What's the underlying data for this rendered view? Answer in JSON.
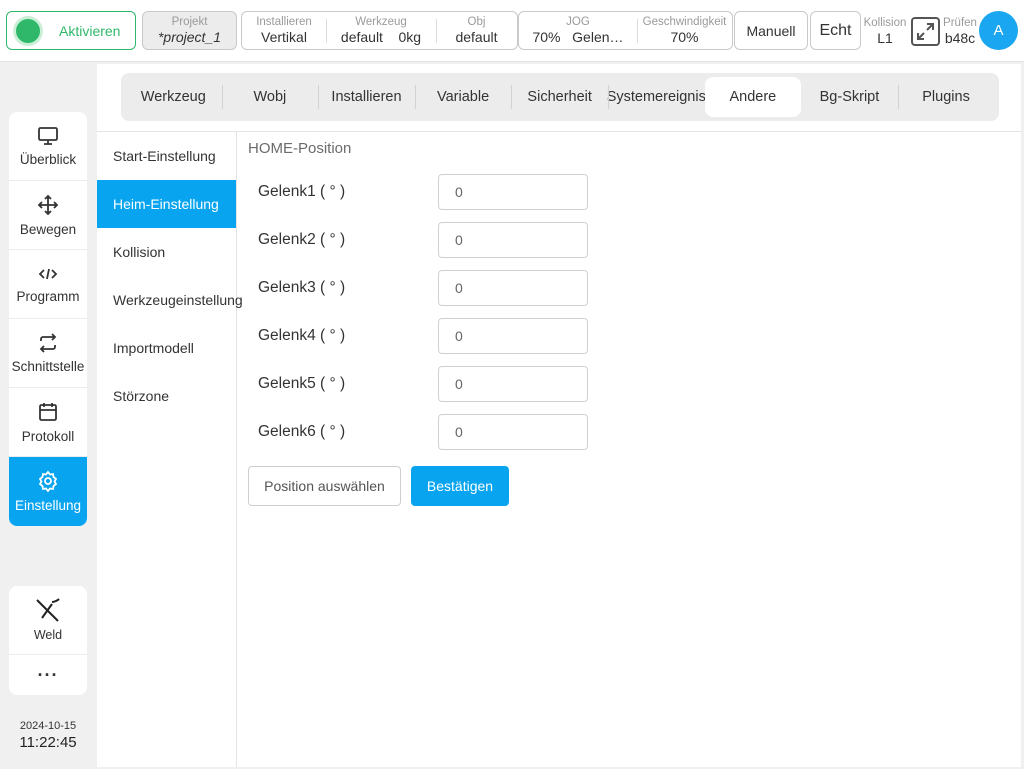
{
  "topbar": {
    "activate_label": "Aktivieren",
    "project": {
      "caption": "Projekt",
      "value": "*project_1"
    },
    "install": {
      "caption": "Installieren",
      "value": "Vertikal"
    },
    "tool": {
      "caption": "Werkzeug",
      "value": "default",
      "extra": "0kg"
    },
    "obj": {
      "caption": "Obj",
      "value": "default"
    },
    "jog": {
      "caption": "JOG",
      "value": "70%",
      "extra": "Gelen…"
    },
    "speed": {
      "caption": "Geschwindigkeit",
      "value": "70%"
    },
    "mode_button": "Manuell",
    "real_button": "Echt",
    "collision": {
      "caption": "Kollision",
      "value": "L1"
    },
    "check": {
      "caption": "Prüfen",
      "value": "b48c"
    },
    "avatar_letter": "A",
    "colors": {
      "active_green": "#2fb86a",
      "accent_blue": "#08a4ef"
    }
  },
  "leftnav": {
    "items": [
      {
        "label": "Überblick",
        "icon": "monitor-icon"
      },
      {
        "label": "Bewegen",
        "icon": "move-arrows-icon"
      },
      {
        "label": "Programm",
        "icon": "code-icon"
      },
      {
        "label": "Schnittstelle",
        "icon": "swap-arrows-icon"
      },
      {
        "label": "Protokoll",
        "icon": "calendar-icon"
      },
      {
        "label": "Einstellung",
        "icon": "gear-icon",
        "active": true
      }
    ],
    "weld_label": "Weld",
    "more_label": "···"
  },
  "clock": {
    "date": "2024-10-15",
    "time": "11:22:45"
  },
  "tabs": [
    "Werkzeug",
    "Wobj",
    "Installieren",
    "Variable",
    "Sicherheit",
    "Systemereignis",
    "Andere",
    "Bg-Skript",
    "Plugins"
  ],
  "active_tab": "Andere",
  "subnav": [
    "Start-Einstellung",
    "Heim-Einstellung",
    "Kollision",
    "Werkzeugeinstellung",
    "Importmodell",
    "Störzone"
  ],
  "active_subnav": "Heim-Einstellung",
  "home": {
    "title": "HOME-Position",
    "joints": [
      {
        "label": "Gelenk1 ( ° )",
        "value": "0"
      },
      {
        "label": "Gelenk2 ( ° )",
        "value": "0"
      },
      {
        "label": "Gelenk3 ( ° )",
        "value": "0"
      },
      {
        "label": "Gelenk4 ( ° )",
        "value": "0"
      },
      {
        "label": "Gelenk5 ( ° )",
        "value": "0"
      },
      {
        "label": "Gelenk6 ( ° )",
        "value": "0"
      }
    ],
    "select_button": "Position auswählen",
    "confirm_button": "Bestätigen"
  }
}
